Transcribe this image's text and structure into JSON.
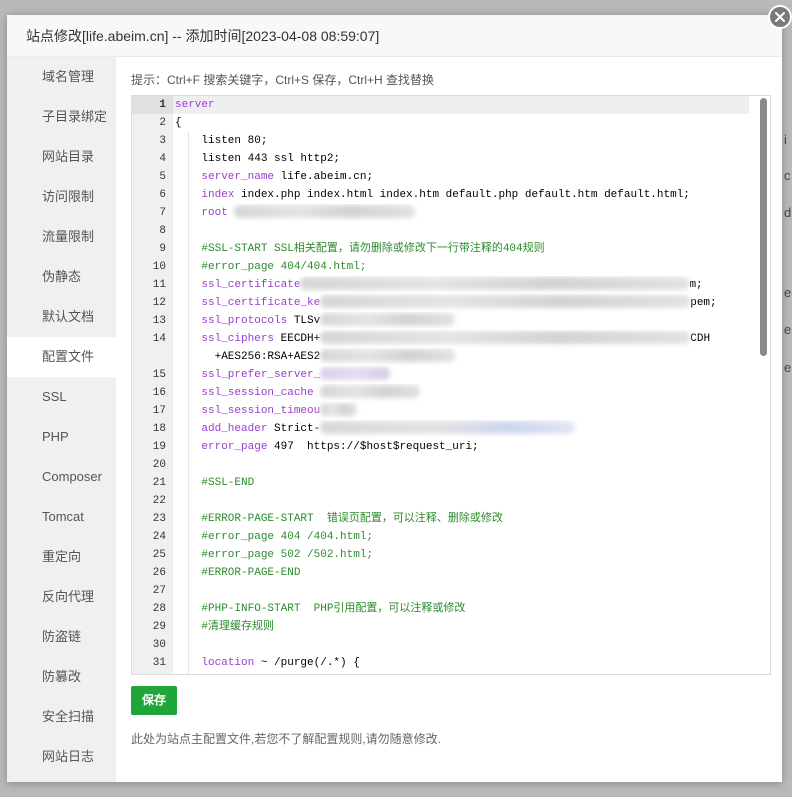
{
  "dialog": {
    "title": "站点修改[life.abeim.cn] -- 添加时间[2023-04-08 08:59:07]",
    "close_icon": "close-icon"
  },
  "sidebar": {
    "items": [
      {
        "label": "域名管理"
      },
      {
        "label": "子目录绑定"
      },
      {
        "label": "网站目录"
      },
      {
        "label": "访问限制"
      },
      {
        "label": "流量限制"
      },
      {
        "label": "伪静态"
      },
      {
        "label": "默认文档"
      },
      {
        "label": "配置文件",
        "active": true
      },
      {
        "label": "SSL"
      },
      {
        "label": "PHP"
      },
      {
        "label": "Composer"
      },
      {
        "label": "Tomcat"
      },
      {
        "label": "重定向"
      },
      {
        "label": "反向代理"
      },
      {
        "label": "防盗链"
      },
      {
        "label": "防篡改"
      },
      {
        "label": "安全扫描"
      },
      {
        "label": "网站日志"
      }
    ]
  },
  "hint": "提示：Ctrl+F 搜索关键字，Ctrl+S 保存，Ctrl+H 查找替换",
  "editor": {
    "active_line": 1,
    "lines": [
      {
        "n": 1,
        "tokens": [
          {
            "t": "kw",
            "v": "server"
          }
        ]
      },
      {
        "n": 2,
        "tokens": [
          {
            "t": "p",
            "v": "{"
          }
        ]
      },
      {
        "n": 3,
        "tokens": [
          {
            "t": "p",
            "v": "    listen 80;"
          }
        ]
      },
      {
        "n": 4,
        "tokens": [
          {
            "t": "p",
            "v": "    listen 443 ssl http2;"
          }
        ]
      },
      {
        "n": 5,
        "tokens": [
          {
            "t": "p",
            "v": "    "
          },
          {
            "t": "kw",
            "v": "server_name"
          },
          {
            "t": "p",
            "v": " life.abeim.cn;"
          }
        ]
      },
      {
        "n": 6,
        "tokens": [
          {
            "t": "p",
            "v": "    "
          },
          {
            "t": "kw",
            "v": "index"
          },
          {
            "t": "p",
            "v": " index.php index.html index.htm default.php default.htm default.html;"
          }
        ]
      },
      {
        "n": 7,
        "tokens": [
          {
            "t": "p",
            "v": "    "
          },
          {
            "t": "kw",
            "v": "root"
          },
          {
            "t": "p",
            "v": " "
          },
          {
            "t": "x"
          }
        ]
      },
      {
        "n": 8,
        "tokens": []
      },
      {
        "n": 9,
        "tokens": [
          {
            "t": "c",
            "v": "    #SSL-START SSL相关配置，请勿删除或修改下一行带注释的404规则"
          }
        ]
      },
      {
        "n": 10,
        "tokens": [
          {
            "t": "c",
            "v": "    #error_page 404/404.html;"
          }
        ]
      },
      {
        "n": 11,
        "tokens": [
          {
            "t": "p",
            "v": "    "
          },
          {
            "t": "kw",
            "v": "ssl_certificate"
          },
          {
            "t": "x"
          },
          {
            "t": "p",
            "v": "m;"
          }
        ]
      },
      {
        "n": 12,
        "tokens": [
          {
            "t": "p",
            "v": "    "
          },
          {
            "t": "kw",
            "v": "ssl_certificate_ke"
          },
          {
            "t": "x"
          },
          {
            "t": "p",
            "v": "pem;"
          }
        ]
      },
      {
        "n": 13,
        "tokens": [
          {
            "t": "p",
            "v": "    "
          },
          {
            "t": "kw",
            "v": "ssl_protocols"
          },
          {
            "t": "p",
            "v": " TLSv"
          },
          {
            "t": "x"
          }
        ]
      },
      {
        "n": 14,
        "tokens": [
          {
            "t": "p",
            "v": "    "
          },
          {
            "t": "kw",
            "v": "ssl_ciphers"
          },
          {
            "t": "p",
            "v": " EECDH+"
          },
          {
            "t": "x"
          },
          {
            "t": "p",
            "v": "CDH"
          },
          {
            "t": "p",
            "v": "+AES256:RSA+AES2"
          },
          {
            "t": "x"
          }
        ]
      },
      {
        "n": 15,
        "tokens": [
          {
            "t": "p",
            "v": "    "
          },
          {
            "t": "kw",
            "v": "ssl_prefer_server_"
          },
          {
            "t": "x"
          }
        ]
      },
      {
        "n": 16,
        "tokens": [
          {
            "t": "p",
            "v": "    "
          },
          {
            "t": "kw",
            "v": "ssl_session_cache"
          },
          {
            "t": "p",
            "v": " "
          },
          {
            "t": "x"
          }
        ]
      },
      {
        "n": 17,
        "tokens": [
          {
            "t": "p",
            "v": "    "
          },
          {
            "t": "kw",
            "v": "ssl_session_timeou"
          },
          {
            "t": "x"
          }
        ]
      },
      {
        "n": 18,
        "tokens": [
          {
            "t": "p",
            "v": "    "
          },
          {
            "t": "kw",
            "v": "add_header"
          },
          {
            "t": "p",
            "v": " Strict-"
          },
          {
            "t": "x"
          }
        ]
      },
      {
        "n": 19,
        "tokens": [
          {
            "t": "p",
            "v": "    "
          },
          {
            "t": "kw",
            "v": "error_page"
          },
          {
            "t": "p",
            "v": " 497  https://$host$request_uri;"
          }
        ]
      },
      {
        "n": 20,
        "tokens": []
      },
      {
        "n": 21,
        "tokens": [
          {
            "t": "c",
            "v": "    #SSL-END"
          }
        ]
      },
      {
        "n": 22,
        "tokens": []
      },
      {
        "n": 23,
        "tokens": [
          {
            "t": "c",
            "v": "    #ERROR-PAGE-START  错误页配置，可以注释、删除或修改"
          }
        ]
      },
      {
        "n": 24,
        "tokens": [
          {
            "t": "c",
            "v": "    #error_page 404 /404.html;"
          }
        ]
      },
      {
        "n": 25,
        "tokens": [
          {
            "t": "c",
            "v": "    #error_page 502 /502.html;"
          }
        ]
      },
      {
        "n": 26,
        "tokens": [
          {
            "t": "c",
            "v": "    #ERROR-PAGE-END"
          }
        ]
      },
      {
        "n": 27,
        "tokens": []
      },
      {
        "n": 28,
        "tokens": [
          {
            "t": "c",
            "v": "    #PHP-INFO-START  PHP引用配置，可以注释或修改"
          }
        ]
      },
      {
        "n": 29,
        "tokens": [
          {
            "t": "c",
            "v": "    #清理缓存规则"
          }
        ]
      },
      {
        "n": 30,
        "tokens": []
      },
      {
        "n": 31,
        "tokens": [
          {
            "t": "p",
            "v": "    "
          },
          {
            "t": "kw",
            "v": "location"
          },
          {
            "t": "p",
            "v": " ~ /purge(/.*) {"
          }
        ]
      }
    ]
  },
  "actions": {
    "save_label": "保存"
  },
  "note": "此处为站点主配置文件,若您不了解配置规则,请勿随意修改.",
  "background_fragments": [
    "i",
    "c",
    "d",
    "e",
    "e",
    "e"
  ],
  "colors": {
    "accent_green": "#20a53a",
    "keyword": "#9a3ccf",
    "comment": "#2e8b2e"
  }
}
